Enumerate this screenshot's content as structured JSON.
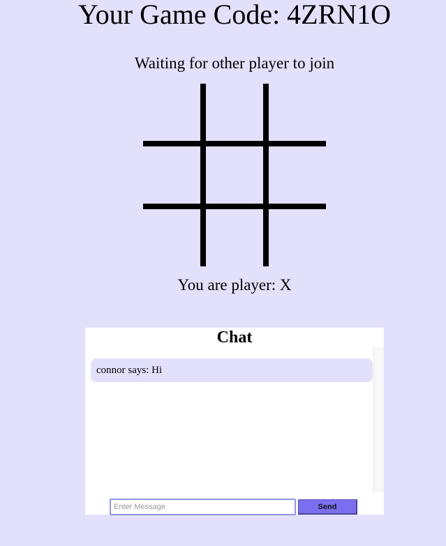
{
  "header": {
    "game_code_label": "Your Game Code: 4ZRN1O"
  },
  "status": {
    "text": "Waiting for other player to join"
  },
  "board": {
    "cells": [
      "",
      "",
      "",
      "",
      "",
      "",
      "",
      "",
      ""
    ]
  },
  "player": {
    "label": "You are player: X"
  },
  "chat": {
    "title": "Chat",
    "messages": [
      {
        "text": "connor says: Hi"
      }
    ],
    "input": {
      "value": "",
      "placeholder": "Enter Message"
    },
    "send_label": "Send"
  },
  "colors": {
    "page_background": "#e3e0fc",
    "message_bubble": "#e3e0fc",
    "send_button": "#7b6ff0",
    "input_border": "#8c95ef",
    "board_lines": "#000000"
  }
}
